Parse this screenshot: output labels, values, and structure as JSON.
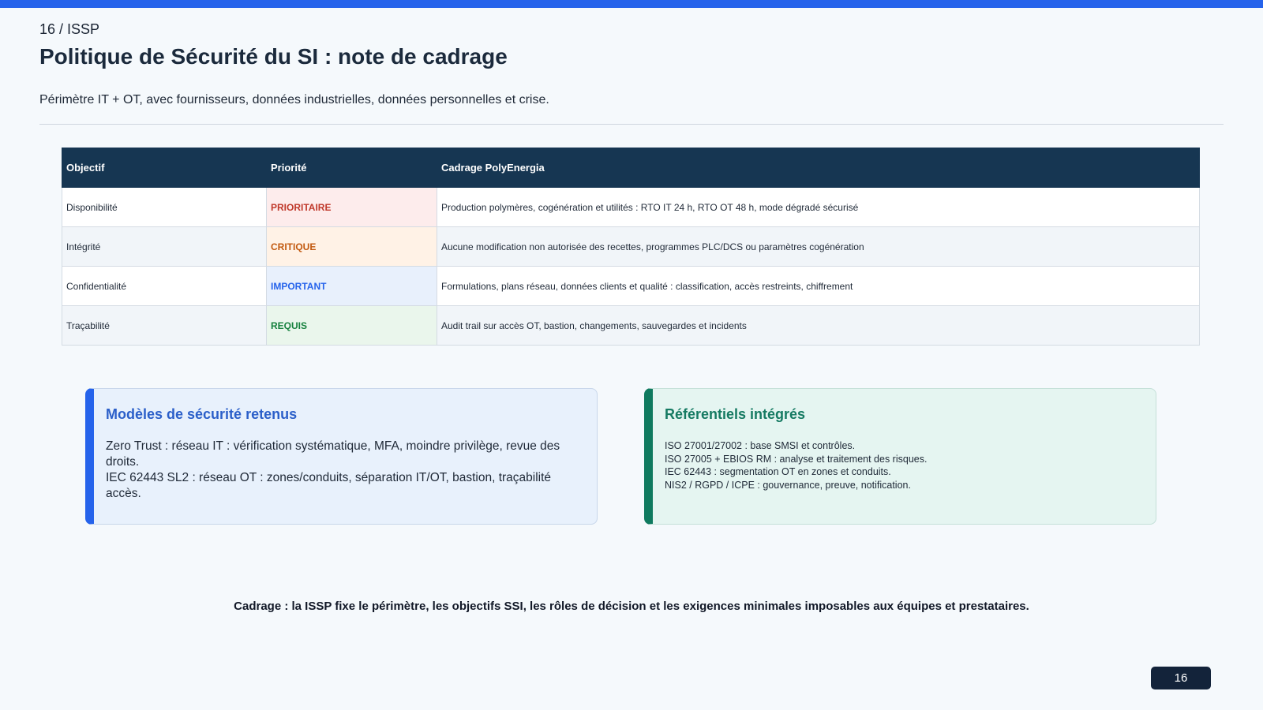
{
  "header": {
    "breadcrumb": "16 / ISSP",
    "title": "Politique de Sécurité du SI : note de cadrage",
    "subtitle": "Périmètre IT + OT, avec fournisseurs, données industrielles, données personnelles et crise."
  },
  "table": {
    "columns": [
      "Objectif",
      "Priorité",
      "Cadrage PolyEnergia"
    ],
    "rows": [
      {
        "objectif": "Disponibilité",
        "priorite": "PRIORITAIRE",
        "priorite_color": "#c0392b",
        "priorite_bg": "#fdecec",
        "cadrage": "Production polymères, cogénération et utilités : RTO IT 24 h, RTO OT 48 h, mode dégradé sécurisé"
      },
      {
        "objectif": "Intégrité",
        "priorite": "CRITIQUE",
        "priorite_color": "#c2590f",
        "priorite_bg": "#fff2e6",
        "cadrage": "Aucune modification non autorisée des recettes, programmes PLC/DCS ou paramètres cogénération"
      },
      {
        "objectif": "Confidentialité",
        "priorite": "IMPORTANT",
        "priorite_color": "#2563eb",
        "priorite_bg": "#e8f0fc",
        "cadrage": "Formulations, plans réseau, données clients et qualité : classification, accès restreints, chiffrement"
      },
      {
        "objectif": "Traçabilité",
        "priorite": "REQUIS",
        "priorite_color": "#15803d",
        "priorite_bg": "#eaf6ec",
        "cadrage": "Audit trail sur accès OT, bastion, changements, sauvegardes et incidents"
      }
    ]
  },
  "cards": {
    "models": {
      "title": "Modèles de sécurité retenus",
      "lines": [
        "Zero Trust : réseau IT : vérification systématique, MFA, moindre privilège, revue des droits.",
        "IEC 62443 SL2 : réseau OT : zones/conduits, séparation IT/OT, bastion, traçabilité accès."
      ]
    },
    "frameworks": {
      "title": "Référentiels intégrés",
      "lines": [
        "ISO 27001/27002 : base SMSI et contrôles.",
        "ISO 27005 + EBIOS RM : analyse et traitement des risques.",
        "IEC 62443 : segmentation OT en zones et conduits.",
        "NIS2 / RGPD / ICPE : gouvernance, preuve, notification."
      ]
    }
  },
  "footer": {
    "note": "Cadrage : la ISSP fixe le périmètre, les objectifs SSI, les rôles de décision et les exigences minimales imposables aux équipes et prestataires.",
    "page_number": "16"
  },
  "colors": {
    "accent": "#2563eb",
    "table_header": "#163652",
    "green_accent": "#0f7a5f"
  }
}
